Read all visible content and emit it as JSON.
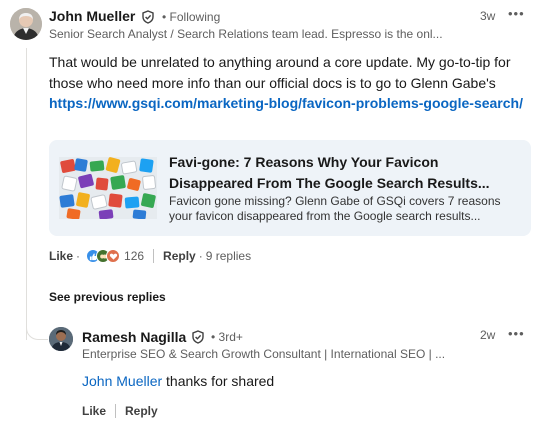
{
  "comment": {
    "author": {
      "name": "John Mueller",
      "connection": "Following",
      "headline": "Senior Search Analyst / Search Relations team lead. Espresso is the onl..."
    },
    "time_ago": "3w",
    "more_icon": "more-horizontal-icon",
    "text_before_link": "That would be unrelated to anything around a core update. My go-to-tip for those who need more info than our official docs is to go to Glenn Gabe's ",
    "link_text": "https://www.gsqi.com/marketing-blog/favicon-problems-google-search/",
    "preview_card": {
      "title": "Favi-gone: 7 Reasons Why Your Favicon Disappeared From The Google Search Results...",
      "description": "Favicon gone missing? Glenn Gabe of GSQi covers 7 reasons your favicon disappeared from the Google search results..."
    },
    "actions": {
      "like": "Like",
      "reaction_count": "126",
      "reply": "Reply",
      "replies_count": "9 replies"
    },
    "reactions": [
      "like",
      "celebrate",
      "love"
    ],
    "colors": {
      "like": "#378fe9",
      "celebrate": "#44712e",
      "love": "#df704d",
      "link": "#0a66c2"
    }
  },
  "see_previous_replies": "See previous replies",
  "reply": {
    "author": {
      "name": "Ramesh Nagilla",
      "connection": "3rd+",
      "headline": "Enterprise SEO & Search Growth Consultant | International SEO | ..."
    },
    "time_ago": "2w",
    "mention": "John Mueller",
    "text": " thanks for shared",
    "actions": {
      "like": "Like",
      "reply": "Reply"
    }
  }
}
